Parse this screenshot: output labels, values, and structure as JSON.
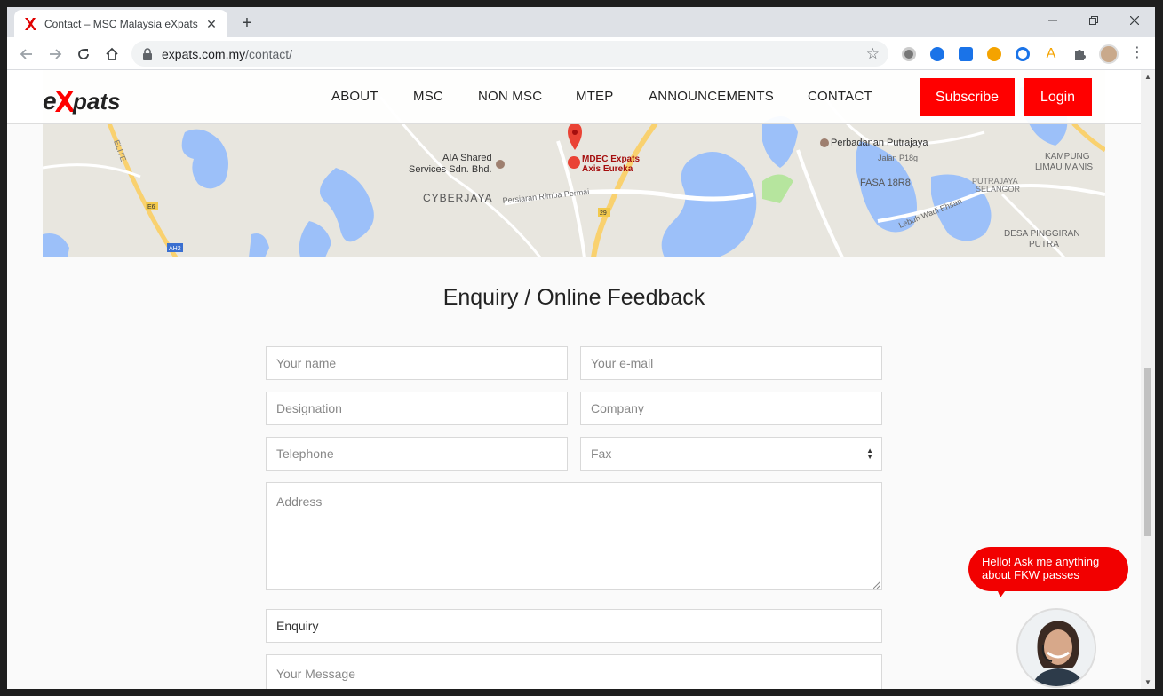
{
  "browser": {
    "tab_title": "Contact – MSC Malaysia eXpats C",
    "url_host": "expats.com.my",
    "url_path": "/contact/"
  },
  "site": {
    "logo_text": "eXpats",
    "nav": [
      {
        "label": "ABOUT"
      },
      {
        "label": "MSC"
      },
      {
        "label": "NON MSC"
      },
      {
        "label": "MTEP"
      },
      {
        "label": "ANNOUNCEMENTS"
      },
      {
        "label": "CONTACT"
      }
    ],
    "subscribe_label": "Subscribe",
    "login_label": "Login",
    "brand_color": "#ff0000"
  },
  "map": {
    "labels": {
      "marker_line1": "MDEC Expats",
      "marker_line2": "Axis Eureka",
      "aia_line1": "AIA Shared",
      "aia_line2": "Services Sdn. Bhd.",
      "cyberjaya": "CYBERJAYA",
      "rimba": "Persiaran Rimba Permai",
      "perbadanan": "Perbadanan Putrajaya",
      "kampung1": "KAMPUNG",
      "kampung2": "LIMAU MANIS",
      "fasa": "FASA 18R8",
      "putrajaya1": "PUTRAJAYA",
      "putrajaya2": "SELANGOR",
      "desa1": "DESA PINGGIRAN",
      "desa2": "PUTRA",
      "elite": "ELITE",
      "e6": "E6",
      "ah2": "AH2",
      "r29": "29",
      "lebuh": "Lebuh Wadi Ehsan",
      "jalan": "Jalan P18g"
    }
  },
  "form": {
    "title": "Enquiry / Online Feedback",
    "your_name": "Your name",
    "your_email": "Your e-mail",
    "designation": "Designation",
    "company": "Company",
    "telephone": "Telephone",
    "fax": "Fax",
    "address": "Address",
    "enquiry_value": "Enquiry",
    "message": "Your Message"
  },
  "chat": {
    "bubble_text": "Hello! Ask me anything about FKW passes"
  }
}
